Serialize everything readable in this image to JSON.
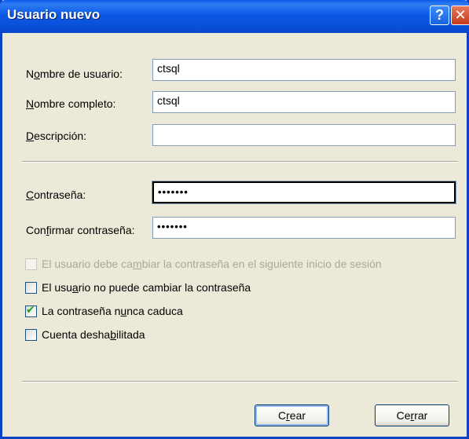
{
  "window": {
    "title": "Usuario nuevo",
    "help_glyph": "?",
    "close_glyph": "✕"
  },
  "form": {
    "username_label": [
      "N",
      "o",
      "mbre de usuario:"
    ],
    "username_value": "ctsql",
    "fullname_label": [
      "",
      "N",
      "ombre completo:"
    ],
    "fullname_value": "ctsql",
    "description_label": [
      "",
      "D",
      "escripción:"
    ],
    "description_value": "",
    "password_label": [
      "",
      "C",
      "ontraseña:"
    ],
    "password_value": "•••••••",
    "confirm_label": [
      "Con",
      "f",
      "irmar contraseña:"
    ],
    "confirm_value": "•••••••"
  },
  "options": [
    {
      "pre": "El usuario debe ca",
      "u": "m",
      "post": "biar la contraseña en el siguiente inicio de sesión",
      "checked": false,
      "disabled": true
    },
    {
      "pre": "El usu",
      "u": "a",
      "post": "rio no puede cambiar la contraseña",
      "checked": false,
      "disabled": false
    },
    {
      "pre": "La contraseña n",
      "u": "u",
      "post": "nca caduca",
      "checked": true,
      "disabled": false
    },
    {
      "pre": "Cuenta desha",
      "u": "b",
      "post": "ilitada",
      "checked": false,
      "disabled": false
    }
  ],
  "buttons": {
    "create": [
      "C",
      "r",
      "ear"
    ],
    "close": [
      "Ce",
      "r",
      "rar"
    ]
  },
  "colors": {
    "titlebar": "#0a5bea",
    "dialog_bg": "#ece9d8",
    "check_tick": "#21a121"
  }
}
